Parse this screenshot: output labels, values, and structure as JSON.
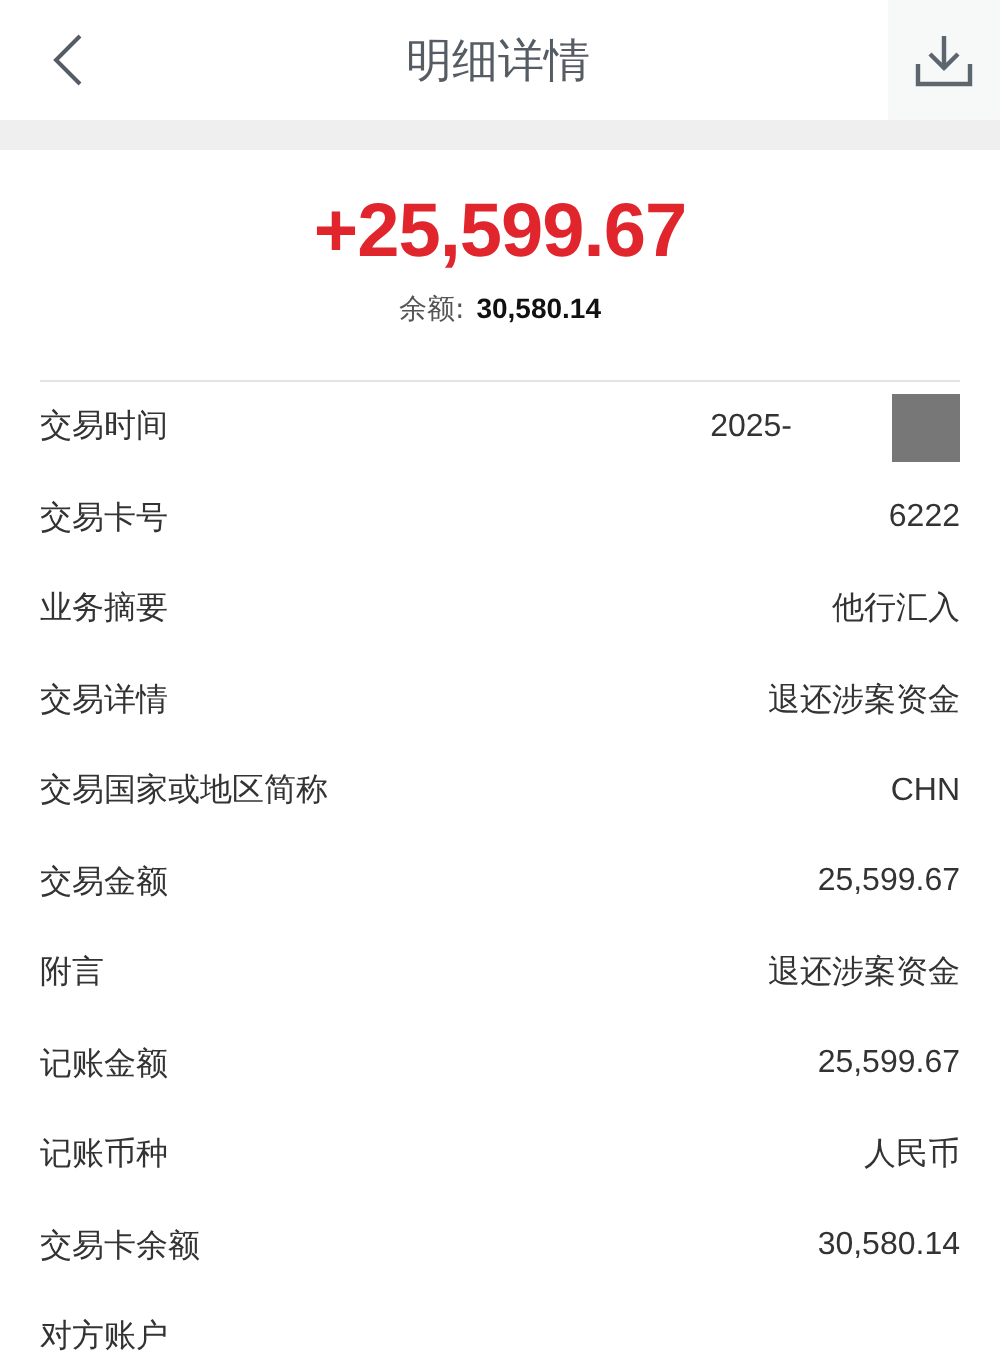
{
  "header": {
    "title": "明细详情"
  },
  "summary": {
    "amount": "+25,599.67",
    "balance_label": "余额:",
    "balance": "30,580.14"
  },
  "rows": [
    {
      "label": "交易时间",
      "value": "2025-",
      "redacted": true
    },
    {
      "label": "交易卡号",
      "value": "6222",
      "redacted": false
    },
    {
      "label": "业务摘要",
      "value": "他行汇入",
      "redacted": false
    },
    {
      "label": "交易详情",
      "value": "退还涉案资金",
      "redacted": false
    },
    {
      "label": "交易国家或地区简称",
      "value": "CHN",
      "redacted": false
    },
    {
      "label": "交易金额",
      "value": "25,599.67",
      "redacted": false
    },
    {
      "label": "附言",
      "value": "退还涉案资金",
      "redacted": false
    },
    {
      "label": "记账金额",
      "value": "25,599.67",
      "redacted": false
    },
    {
      "label": "记账币种",
      "value": "人民币",
      "redacted": false
    },
    {
      "label": "交易卡余额",
      "value": "30,580.14",
      "redacted": false
    },
    {
      "label": "对方账户",
      "redacted": false
    }
  ]
}
